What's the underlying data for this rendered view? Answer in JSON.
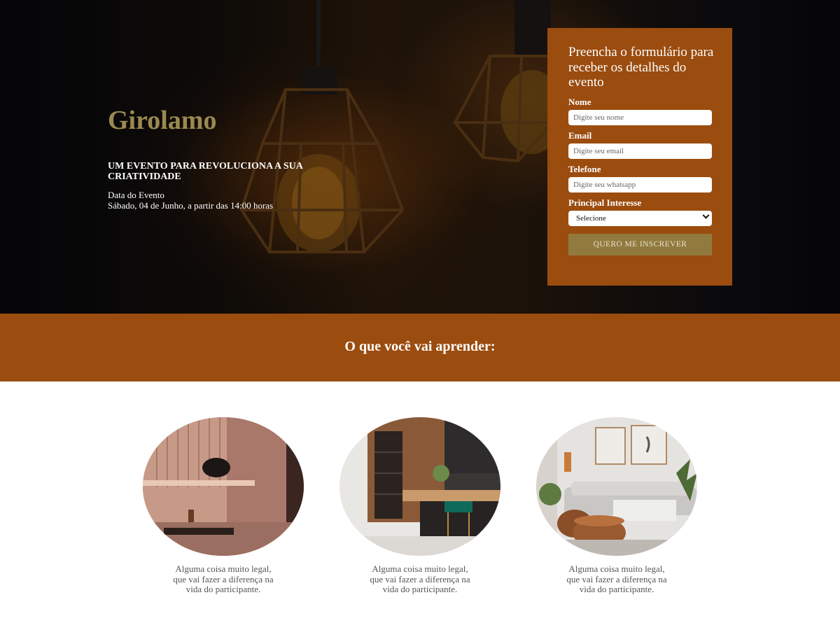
{
  "hero": {
    "brand": "Girolamo",
    "tagline": "UM EVENTO PARA REVOLUCIONA A SUA CRIATIVIDADE",
    "date_label": "Data do Evento",
    "date_value": "Sábado, 04 de Junho, a partir das 14:00 horas"
  },
  "form": {
    "title": "Preencha o formulário para receber os detalhes do evento",
    "name_label": "Nome",
    "name_placeholder": "Digite seu nome",
    "email_label": "Email",
    "email_placeholder": "Digite seu email",
    "phone_label": "Telefone",
    "phone_placeholder": "Digite seu whatsapp",
    "interest_label": "Principal Interesse",
    "interest_selected": "Selecione",
    "submit_label": "QUERO ME INSCREVER"
  },
  "learn": {
    "title": "O que você vai aprender:",
    "items": [
      {
        "line1": "Alguma coisa muito legal,",
        "line2": "que vai fazer a diferença na",
        "line3": "vida do participante."
      },
      {
        "line1": "Alguma coisa muito legal,",
        "line2": "que vai fazer a diferença na",
        "line3": "vida do participante."
      },
      {
        "line1": "Alguma coisa muito legal,",
        "line2": "que vai fazer a diferença na",
        "line3": "vida do participante."
      }
    ]
  },
  "colors": {
    "accent_brown": "#9b4c0f",
    "brand_gold": "#9a8a50",
    "button_gold": "#917a3d",
    "hero_dark": "#0b0a0c"
  },
  "icons": {
    "select_arrow": "chevron-down-icon"
  }
}
